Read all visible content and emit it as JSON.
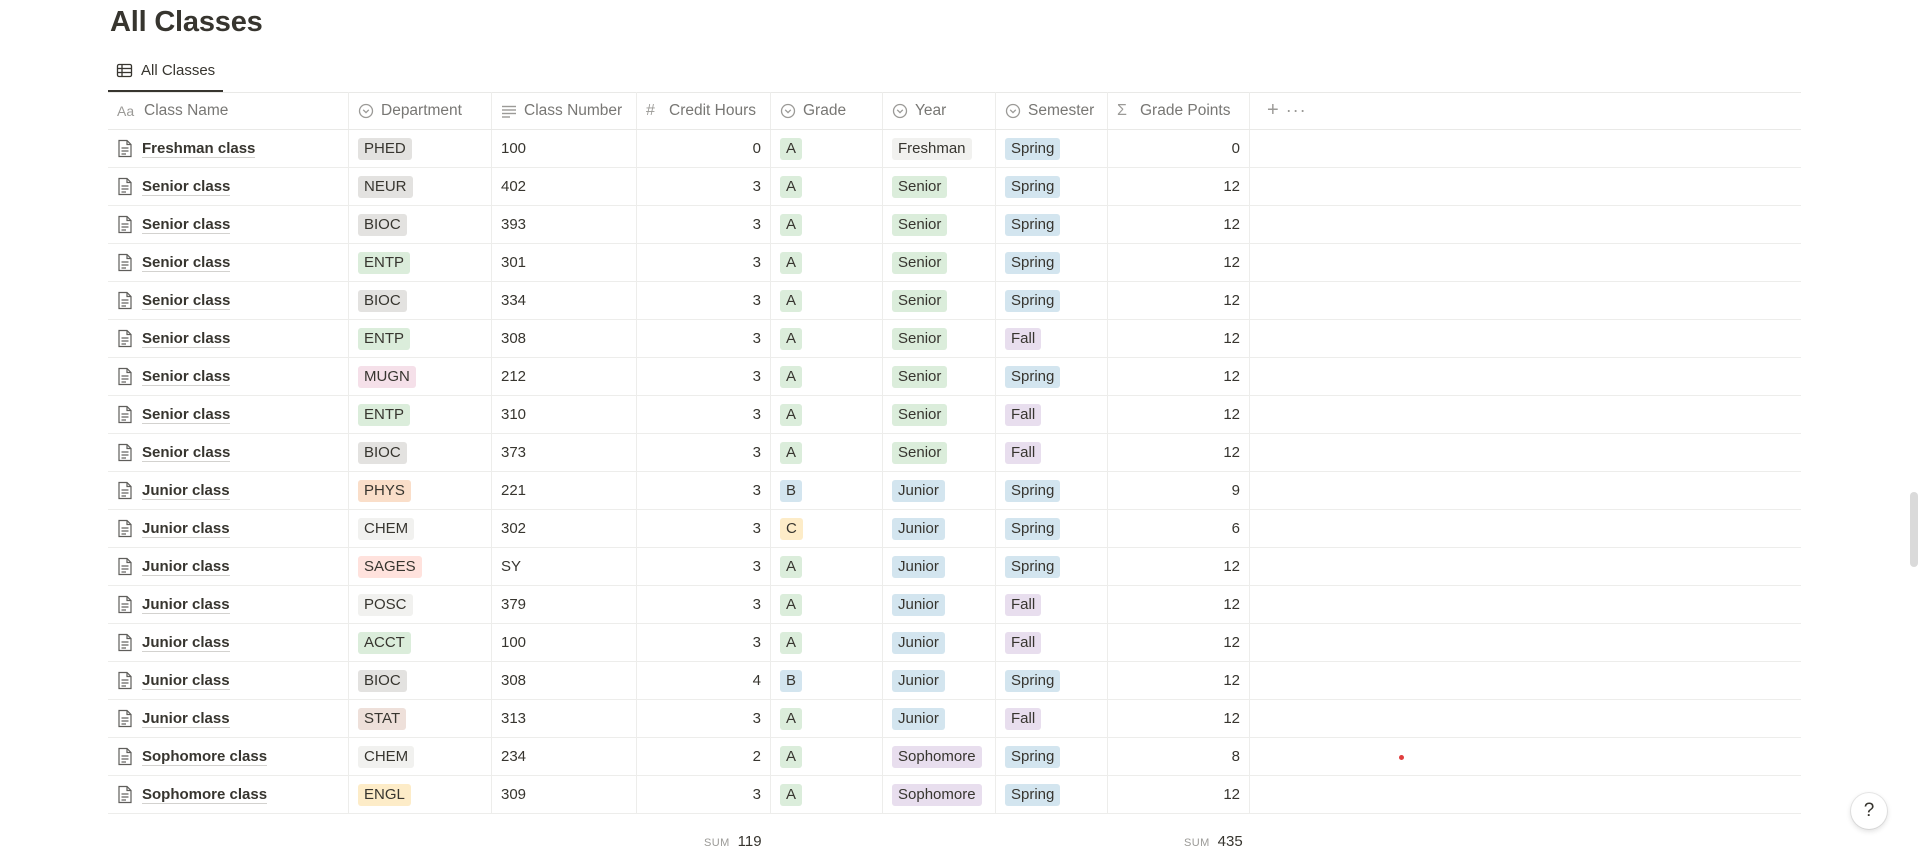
{
  "page": {
    "title": "All Classes",
    "view_tab_label": "All Classes"
  },
  "columns": {
    "class_name": "Class Name",
    "department": "Department",
    "class_number": "Class Number",
    "credit_hours": "Credit Hours",
    "grade": "Grade",
    "year": "Year",
    "semester": "Semester",
    "grade_points": "Grade Points"
  },
  "header_icons": {
    "class_name": "title-property-icon",
    "department": "select-property-icon",
    "class_number": "text-property-icon",
    "credit_hours": "number-property-icon",
    "grade": "select-property-icon",
    "year": "select-property-icon",
    "semester": "select-property-icon",
    "grade_points": "formula-property-icon",
    "add": "plus-icon",
    "more": "more-options-icon"
  },
  "colors": {
    "gray": "#e3e2e0",
    "green": "#dbeddb",
    "pink": "#f5e0e9",
    "orange": "#fadec9",
    "yellow": "#fdecc8",
    "red": "#ffe2dd",
    "blue": "#d3e5ef",
    "purple": "#e8deee",
    "brown": "#eee0da",
    "lightgray": "#f1f1ef",
    "dot": "#e03e3e"
  },
  "rows": [
    {
      "name": "Freshman class",
      "dept": "PHED",
      "dept_color": "gray",
      "number": "100",
      "credits": "0",
      "grade": "A",
      "grade_color": "green",
      "year": "Freshman",
      "year_color": "lightgray",
      "semester": "Spring",
      "semester_color": "blue",
      "points": "0"
    },
    {
      "name": "Senior class",
      "dept": "NEUR",
      "dept_color": "gray",
      "number": "402",
      "credits": "3",
      "grade": "A",
      "grade_color": "green",
      "year": "Senior",
      "year_color": "green",
      "semester": "Spring",
      "semester_color": "blue",
      "points": "12"
    },
    {
      "name": "Senior class",
      "dept": "BIOC",
      "dept_color": "gray",
      "number": "393",
      "credits": "3",
      "grade": "A",
      "grade_color": "green",
      "year": "Senior",
      "year_color": "green",
      "semester": "Spring",
      "semester_color": "blue",
      "points": "12"
    },
    {
      "name": "Senior class",
      "dept": "ENTP",
      "dept_color": "green",
      "number": "301",
      "credits": "3",
      "grade": "A",
      "grade_color": "green",
      "year": "Senior",
      "year_color": "green",
      "semester": "Spring",
      "semester_color": "blue",
      "points": "12"
    },
    {
      "name": "Senior class",
      "dept": "BIOC",
      "dept_color": "gray",
      "number": "334",
      "credits": "3",
      "grade": "A",
      "grade_color": "green",
      "year": "Senior",
      "year_color": "green",
      "semester": "Spring",
      "semester_color": "blue",
      "points": "12"
    },
    {
      "name": "Senior class",
      "dept": "ENTP",
      "dept_color": "green",
      "number": "308",
      "credits": "3",
      "grade": "A",
      "grade_color": "green",
      "year": "Senior",
      "year_color": "green",
      "semester": "Fall",
      "semester_color": "purple",
      "points": "12"
    },
    {
      "name": "Senior class",
      "dept": "MUGN",
      "dept_color": "pink",
      "number": "212",
      "credits": "3",
      "grade": "A",
      "grade_color": "green",
      "year": "Senior",
      "year_color": "green",
      "semester": "Spring",
      "semester_color": "blue",
      "points": "12"
    },
    {
      "name": "Senior class",
      "dept": "ENTP",
      "dept_color": "green",
      "number": "310",
      "credits": "3",
      "grade": "A",
      "grade_color": "green",
      "year": "Senior",
      "year_color": "green",
      "semester": "Fall",
      "semester_color": "purple",
      "points": "12"
    },
    {
      "name": "Senior class",
      "dept": "BIOC",
      "dept_color": "gray",
      "number": "373",
      "credits": "3",
      "grade": "A",
      "grade_color": "green",
      "year": "Senior",
      "year_color": "green",
      "semester": "Fall",
      "semester_color": "purple",
      "points": "12"
    },
    {
      "name": "Junior class",
      "dept": "PHYS",
      "dept_color": "orange",
      "number": "221",
      "credits": "3",
      "grade": "B",
      "grade_color": "blue",
      "year": "Junior",
      "year_color": "blue",
      "semester": "Spring",
      "semester_color": "blue",
      "points": "9"
    },
    {
      "name": "Junior class",
      "dept": "CHEM",
      "dept_color": "lightgray",
      "number": "302",
      "credits": "3",
      "grade": "C",
      "grade_color": "yellow",
      "year": "Junior",
      "year_color": "blue",
      "semester": "Spring",
      "semester_color": "blue",
      "points": "6"
    },
    {
      "name": "Junior class",
      "dept": "SAGES",
      "dept_color": "red",
      "number": "SY",
      "credits": "3",
      "grade": "A",
      "grade_color": "green",
      "year": "Junior",
      "year_color": "blue",
      "semester": "Spring",
      "semester_color": "blue",
      "points": "12"
    },
    {
      "name": "Junior class",
      "dept": "POSC",
      "dept_color": "lightgray",
      "number": "379",
      "credits": "3",
      "grade": "A",
      "grade_color": "green",
      "year": "Junior",
      "year_color": "blue",
      "semester": "Fall",
      "semester_color": "purple",
      "points": "12"
    },
    {
      "name": "Junior class",
      "dept": "ACCT",
      "dept_color": "green",
      "number": "100",
      "credits": "3",
      "grade": "A",
      "grade_color": "green",
      "year": "Junior",
      "year_color": "blue",
      "semester": "Fall",
      "semester_color": "purple",
      "points": "12"
    },
    {
      "name": "Junior class",
      "dept": "BIOC",
      "dept_color": "gray",
      "number": "308",
      "credits": "4",
      "grade": "B",
      "grade_color": "blue",
      "year": "Junior",
      "year_color": "blue",
      "semester": "Spring",
      "semester_color": "blue",
      "points": "12"
    },
    {
      "name": "Junior class",
      "dept": "STAT",
      "dept_color": "brown",
      "number": "313",
      "credits": "3",
      "grade": "A",
      "grade_color": "green",
      "year": "Junior",
      "year_color": "blue",
      "semester": "Fall",
      "semester_color": "purple",
      "points": "12"
    },
    {
      "name": "Sophomore class",
      "dept": "CHEM",
      "dept_color": "lightgray",
      "number": "234",
      "credits": "2",
      "grade": "A",
      "grade_color": "green",
      "year": "Sophomore",
      "year_color": "purple",
      "semester": "Spring",
      "semester_color": "blue",
      "points": "8"
    },
    {
      "name": "Sophomore class",
      "dept": "ENGL",
      "dept_color": "yellow",
      "number": "309",
      "credits": "3",
      "grade": "A",
      "grade_color": "green",
      "year": "Sophomore",
      "year_color": "purple",
      "semester": "Spring",
      "semester_color": "blue",
      "points": "12"
    }
  ],
  "footer": {
    "credit_sum_label": "SUM",
    "credit_sum_value": "119",
    "points_sum_label": "SUM",
    "points_sum_value": "435"
  },
  "help": {
    "label": "?"
  }
}
